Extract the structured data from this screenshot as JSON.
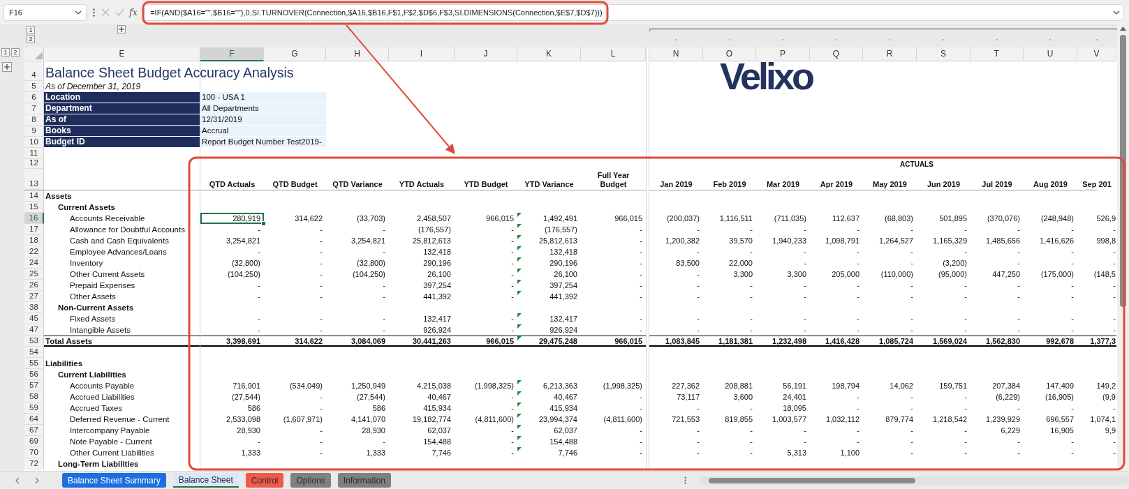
{
  "formula_bar": {
    "name_box": "F16",
    "function_label": "fx",
    "formula": "=IF(AND($A16=\"\",$B16=\"\"),0,SI.TURNOVER(Connection,$A16,$B16,F$1,F$2,$D$6,F$3,SI.DIMENSIONS(Connection,$E$7,$D$7)))"
  },
  "outline": {
    "column_levels": [
      "1",
      "2"
    ],
    "row_levels": [
      "1",
      "2"
    ]
  },
  "logo": "Velixo",
  "columns": [
    {
      "label": "E",
      "selected": false
    },
    {
      "label": "F",
      "selected": true
    },
    {
      "label": "G",
      "selected": false
    },
    {
      "label": "H",
      "selected": false
    },
    {
      "label": "I",
      "selected": false
    },
    {
      "label": "J",
      "selected": false
    },
    {
      "label": "K",
      "selected": false
    },
    {
      "label": "L",
      "selected": false
    },
    {
      "label": "N",
      "selected": false
    },
    {
      "label": "O",
      "selected": false
    },
    {
      "label": "P",
      "selected": false
    },
    {
      "label": "Q",
      "selected": false
    },
    {
      "label": "R",
      "selected": false
    },
    {
      "label": "S",
      "selected": false
    },
    {
      "label": "T",
      "selected": false
    },
    {
      "label": "U",
      "selected": false
    },
    {
      "label": "V",
      "selected": false
    }
  ],
  "rows": [
    {
      "number": "4",
      "kind": "title",
      "selected": false,
      "label": "Balance Sheet Budget Accuracy Analysis"
    },
    {
      "number": "5",
      "kind": "subtitle",
      "selected": false,
      "label": "As of December 31, 2019"
    },
    {
      "number": "6",
      "kind": "parameter",
      "selected": false,
      "label": "Location",
      "value": "100 - USA 1"
    },
    {
      "number": "7",
      "kind": "parameter",
      "selected": false,
      "label": "Department",
      "value": "All Departments"
    },
    {
      "number": "8",
      "kind": "parameter",
      "selected": false,
      "label": "As of",
      "value": "12/31/2019"
    },
    {
      "number": "9",
      "kind": "parameter",
      "selected": false,
      "label": "Books",
      "value": "Accrual"
    },
    {
      "number": "10",
      "kind": "parameter",
      "selected": false,
      "label": "Budget ID",
      "value": "Report Budget Number Test2019-"
    },
    {
      "number": "11",
      "kind": "blank",
      "selected": false
    },
    {
      "number": "12",
      "kind": "band",
      "selected": false,
      "group_heading": "ACTUALS"
    },
    {
      "number": "13",
      "kind": "header",
      "selected": false,
      "headers": [
        "QTD Actuals",
        "QTD Budget",
        "QTD Variance",
        "YTD Actuals",
        "YTD Budget",
        "YTD Variance",
        "Full Year Budget",
        "Jan 2019",
        "Feb 2019",
        "Mar 2019",
        "Apr 2019",
        "May 2019",
        "Jun 2019",
        "Jul 2019",
        "Aug 2019",
        "Sep 201"
      ]
    },
    {
      "number": "14",
      "kind": "section",
      "selected": false,
      "label": "Assets"
    },
    {
      "number": "15",
      "kind": "group",
      "selected": false,
      "label": "Current Assets"
    },
    {
      "number": "16",
      "kind": "item",
      "selected": true,
      "flagged": true,
      "label": "Accounts Receivable",
      "values": [
        "280,919",
        "314,622",
        "(33,703)",
        "2,458,507",
        "966,015",
        "1,492,491",
        "966,015",
        "(200,037)",
        "1,116,511",
        "(711,035)",
        "112,637",
        "(68,803)",
        "501,895",
        "(370,076)",
        "(248,948)",
        "526,9"
      ]
    },
    {
      "number": "17",
      "kind": "item",
      "selected": false,
      "flagged": true,
      "label": "Allowance for Doubtful Accounts",
      "values": [
        "-",
        "-",
        "-",
        "(176,557)",
        "-",
        "(176,557)",
        "-",
        "-",
        "-",
        "-",
        "-",
        "-",
        "-",
        "-",
        "-",
        "-"
      ]
    },
    {
      "number": "18",
      "kind": "item",
      "selected": false,
      "flagged": true,
      "label": "Cash and Cash Equivalents",
      "values": [
        "3,254,821",
        "-",
        "3,254,821",
        "25,812,613",
        "-",
        "25,812,613",
        "-",
        "1,200,382",
        "39,570",
        "1,940,233",
        "1,098,791",
        "1,264,527",
        "1,165,329",
        "1,485,656",
        "1,416,626",
        "998,8"
      ]
    },
    {
      "number": "22",
      "kind": "item",
      "selected": false,
      "flagged": true,
      "label": "Employee Advances/Loans",
      "values": [
        "-",
        "-",
        "-",
        "132,418",
        "-",
        "132,418",
        "-",
        "-",
        "-",
        "-",
        "-",
        "-",
        "-",
        "-",
        "-",
        "-"
      ]
    },
    {
      "number": "24",
      "kind": "item",
      "selected": false,
      "flagged": true,
      "label": "Inventory",
      "values": [
        "(32,800)",
        "-",
        "(32,800)",
        "290,196",
        "-",
        "290,196",
        "-",
        "83,500",
        "22,000",
        "-",
        "-",
        "-",
        "(3,200)",
        "-",
        "-",
        "-"
      ]
    },
    {
      "number": "25",
      "kind": "item",
      "selected": false,
      "flagged": true,
      "label": "Other Current Assets",
      "values": [
        "(104,250)",
        "-",
        "(104,250)",
        "26,100",
        "-",
        "26,100",
        "-",
        "-",
        "3,300",
        "3,300",
        "205,000",
        "(110,000)",
        "(95,000)",
        "447,250",
        "(175,000)",
        "(148,5"
      ]
    },
    {
      "number": "26",
      "kind": "item",
      "selected": false,
      "flagged": true,
      "label": "Prepaid Expenses",
      "values": [
        "-",
        "-",
        "-",
        "397,254",
        "-",
        "397,254",
        "-",
        "-",
        "-",
        "-",
        "-",
        "-",
        "-",
        "-",
        "-",
        "-"
      ]
    },
    {
      "number": "27",
      "kind": "item",
      "selected": false,
      "flagged": true,
      "label": "Other Assets",
      "values": [
        "-",
        "-",
        "-",
        "441,392",
        "-",
        "441,392",
        "-",
        "-",
        "-",
        "-",
        "-",
        "-",
        "-",
        "-",
        "-",
        "-"
      ]
    },
    {
      "number": "38",
      "kind": "group",
      "selected": false,
      "label": "Non-Current Assets"
    },
    {
      "number": "45",
      "kind": "item",
      "selected": false,
      "flagged": true,
      "label": "Fixed Assets",
      "values": [
        "-",
        "-",
        "-",
        "132,417",
        "-",
        "132,417",
        "-",
        "-",
        "-",
        "-",
        "-",
        "-",
        "-",
        "-",
        "-",
        "-"
      ]
    },
    {
      "number": "47",
      "kind": "item",
      "selected": false,
      "flagged": true,
      "label": "Intangible Assets",
      "values": [
        "-",
        "-",
        "-",
        "926,924",
        "-",
        "926,924",
        "-",
        "-",
        "-",
        "-",
        "-",
        "-",
        "-",
        "-",
        "-",
        "-"
      ]
    },
    {
      "number": "53",
      "kind": "total",
      "selected": false,
      "flagged": true,
      "label": "Total Assets",
      "values": [
        "3,398,691",
        "314,622",
        "3,084,069",
        "30,441,263",
        "966,015",
        "29,475,248",
        "966,015",
        "1,083,845",
        "1,181,381",
        "1,232,498",
        "1,416,428",
        "1,085,724",
        "1,569,024",
        "1,562,830",
        "992,678",
        "1,377,3"
      ]
    },
    {
      "number": "54",
      "kind": "blank",
      "selected": false
    },
    {
      "number": "55",
      "kind": "section",
      "selected": false,
      "label": "Liabilities"
    },
    {
      "number": "56",
      "kind": "group",
      "selected": false,
      "label": "Current Liabilities"
    },
    {
      "number": "57",
      "kind": "item",
      "selected": false,
      "flagged": true,
      "label": "Accounts Payable",
      "values": [
        "716,901",
        "(534,049)",
        "1,250,949",
        "4,215,038",
        "(1,998,325)",
        "6,213,363",
        "(1,998,325)",
        "227,362",
        "208,881",
        "56,191",
        "198,794",
        "14,062",
        "159,751",
        "207,384",
        "147,409",
        "149,2"
      ]
    },
    {
      "number": "58",
      "kind": "item",
      "selected": false,
      "flagged": true,
      "label": "Accrued Liabilities",
      "values": [
        "(27,544)",
        "-",
        "(27,544)",
        "40,467",
        "-",
        "40,467",
        "-",
        "73,117",
        "3,600",
        "24,401",
        "-",
        "-",
        "-",
        "(6,229)",
        "(16,905)",
        "(9,9"
      ]
    },
    {
      "number": "59",
      "kind": "item",
      "selected": false,
      "flagged": true,
      "label": "Accrued Taxes",
      "values": [
        "586",
        "-",
        "586",
        "415,934",
        "-",
        "415,934",
        "-",
        "-",
        "-",
        "18,095",
        "-",
        "-",
        "-",
        "-",
        "-",
        "-"
      ]
    },
    {
      "number": "64",
      "kind": "item",
      "selected": false,
      "flagged": true,
      "label": "Deferred Revenue - Current",
      "values": [
        "2,533,098",
        "(1,607,971)",
        "4,141,070",
        "19,182,774",
        "(4,811,600)",
        "23,994,374",
        "(4,811,600)",
        "721,553",
        "819,855",
        "1,003,577",
        "1,032,112",
        "879,774",
        "1,218,542",
        "1,239,929",
        "696,557",
        "1,074,1"
      ]
    },
    {
      "number": "67",
      "kind": "item",
      "selected": false,
      "flagged": true,
      "label": "Intercompany Payable",
      "values": [
        "28,930",
        "-",
        "28,930",
        "62,037",
        "-",
        "62,037",
        "-",
        "-",
        "-",
        "-",
        "-",
        "-",
        "-",
        "6,229",
        "16,905",
        "9,9"
      ]
    },
    {
      "number": "69",
      "kind": "item",
      "selected": false,
      "flagged": true,
      "label": "Note Payable - Current",
      "values": [
        "-",
        "-",
        "-",
        "154,488",
        "-",
        "154,488",
        "-",
        "-",
        "-",
        "-",
        "-",
        "-",
        "-",
        "-",
        "-",
        "-"
      ]
    },
    {
      "number": "70",
      "kind": "item",
      "selected": false,
      "flagged": true,
      "label": "Other Current Liabilities",
      "values": [
        "1,333",
        "-",
        "1,333",
        "7,746",
        "-",
        "7,746",
        "-",
        "-",
        "-",
        "5,313",
        "1,100",
        "-",
        "-",
        "-",
        "-",
        "-"
      ]
    },
    {
      "number": "72",
      "kind": "group",
      "selected": false,
      "label": "Long-Term Liabilities"
    }
  ],
  "sheet_tabs": [
    {
      "label": "Balance Sheet Summary",
      "selected": false,
      "color": "#1b6fe0"
    },
    {
      "label": "Balance Sheet",
      "selected": true,
      "color": "#dce6f6"
    },
    {
      "label": "Control",
      "selected": false,
      "color": "#ef5a4a"
    },
    {
      "label": "Options",
      "selected": false,
      "color": "#808080"
    },
    {
      "label": "Information",
      "selected": false,
      "color": "#808080"
    }
  ]
}
